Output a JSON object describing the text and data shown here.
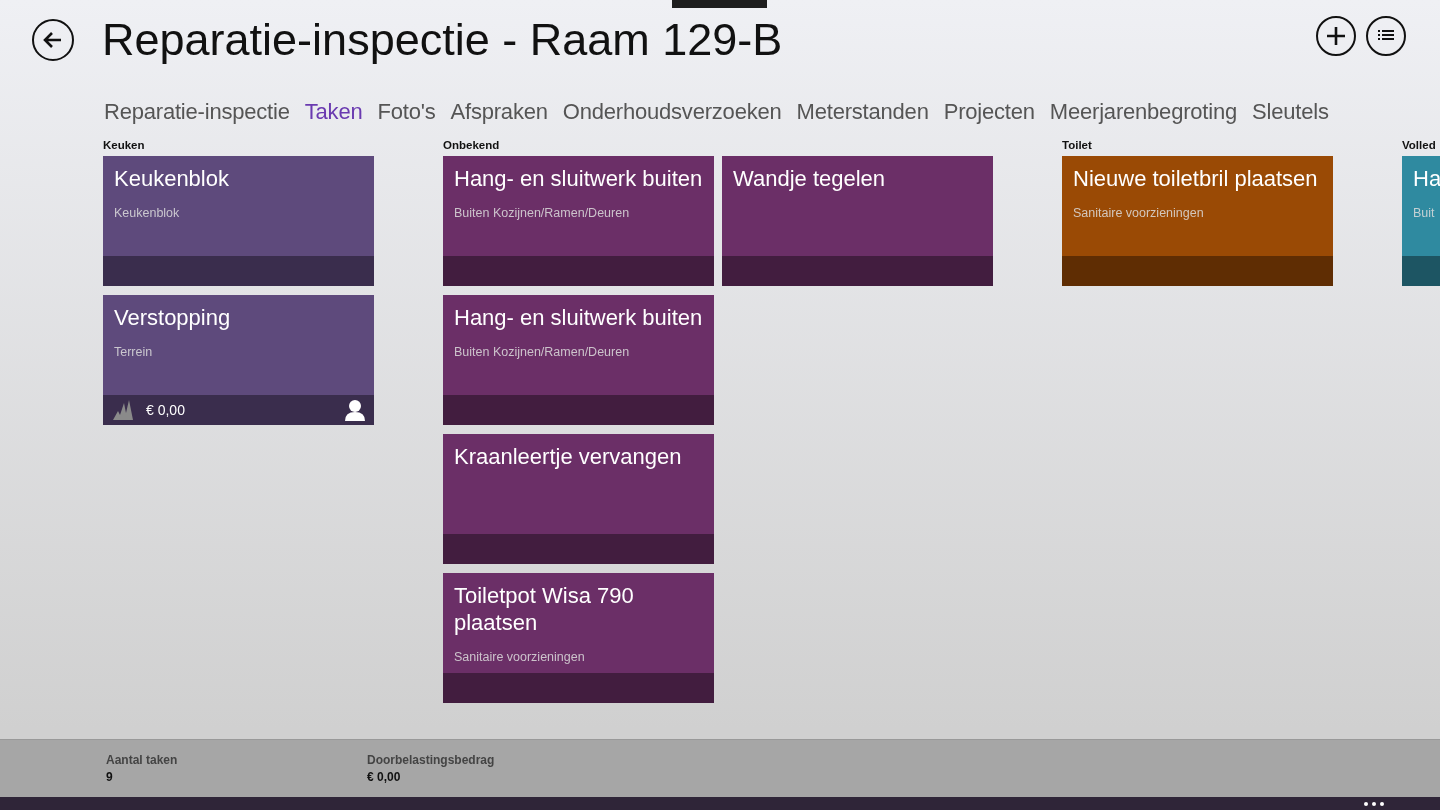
{
  "header": {
    "title": "Reparatie-inspectie - Raam 129-B"
  },
  "tabs": [
    {
      "label": "Reparatie-inspectie",
      "selected": false
    },
    {
      "label": "Taken",
      "selected": true
    },
    {
      "label": "Foto's",
      "selected": false
    },
    {
      "label": "Afspraken",
      "selected": false
    },
    {
      "label": "Onderhoudsverzoeken",
      "selected": false
    },
    {
      "label": "Meterstanden",
      "selected": false
    },
    {
      "label": "Projecten",
      "selected": false
    },
    {
      "label": "Meerjarenbegroting",
      "selected": false
    },
    {
      "label": "Sleutels",
      "selected": false
    }
  ],
  "groups": [
    {
      "name": "Keuken",
      "tiles": [
        {
          "title": "Keukenblok",
          "subtitle": "Keukenblok",
          "color": "#5e4a7c"
        },
        {
          "title": "Verstopping",
          "subtitle": "Terrein",
          "color": "#5e4a7c",
          "amount": "€ 0,00"
        }
      ]
    },
    {
      "name": "Onbekend",
      "tiles": [
        {
          "title": "Hang- en sluitwerk buiten",
          "subtitle": "Buiten Kozijnen/Ramen/Deuren",
          "color": "#6b2f67"
        },
        {
          "title": "Hang- en sluitwerk buiten",
          "subtitle": "Buiten Kozijnen/Ramen/Deuren",
          "color": "#6b2f67"
        },
        {
          "title": "Kraanleertje vervangen",
          "color": "#6b2f67"
        },
        {
          "title": "Toiletpot Wisa 790 plaatsen",
          "subtitle": "Sanitaire voorzieningen",
          "color": "#6b2f67"
        },
        {
          "title": "Wandje tegelen",
          "color": "#6b2f67"
        }
      ]
    },
    {
      "name": "Toilet",
      "tiles": [
        {
          "title": "Nieuwe toiletbril plaatsen",
          "subtitle": "Sanitaire voorzieningen",
          "color": "#9a4a05"
        }
      ]
    },
    {
      "name": "Volled",
      "tiles": [
        {
          "title": "Ha",
          "subtitle": "Buit",
          "color": "#2f8aa0"
        }
      ]
    }
  ],
  "summary": [
    {
      "label": "Aantal taken",
      "value": "9"
    },
    {
      "label": "Doorbelastingsbedrag",
      "value": "€ 0,00"
    }
  ]
}
